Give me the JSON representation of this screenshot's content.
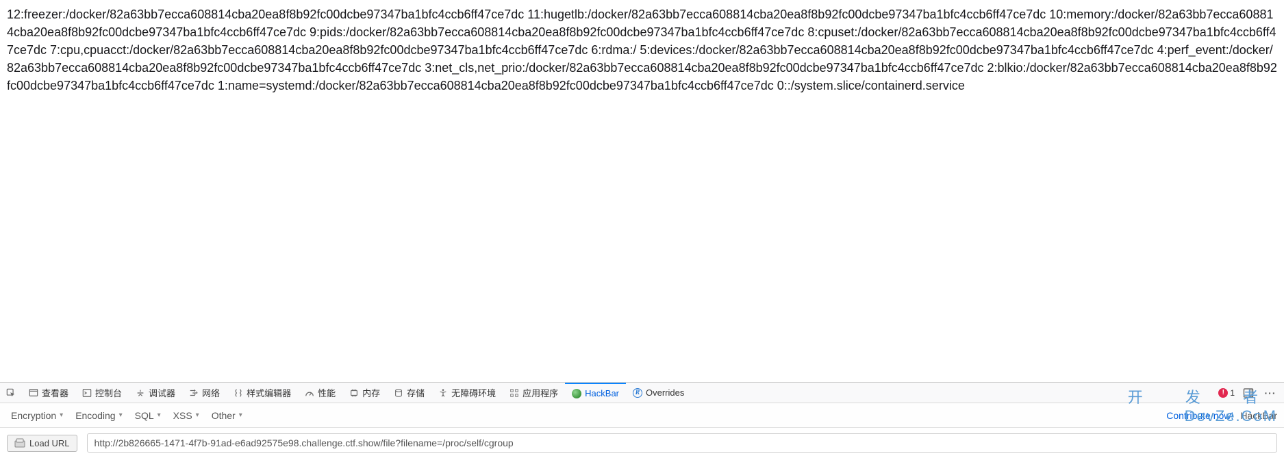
{
  "page_text": "12:freezer:/docker/82a63bb7ecca608814cba20ea8f8b92fc00dcbe97347ba1bfc4ccb6ff47ce7dc 11:hugetlb:/docker/82a63bb7ecca608814cba20ea8f8b92fc00dcbe97347ba1bfc4ccb6ff47ce7dc 10:memory:/docker/82a63bb7ecca608814cba20ea8f8b92fc00dcbe97347ba1bfc4ccb6ff47ce7dc 9:pids:/docker/82a63bb7ecca608814cba20ea8f8b92fc00dcbe97347ba1bfc4ccb6ff47ce7dc 8:cpuset:/docker/82a63bb7ecca608814cba20ea8f8b92fc00dcbe97347ba1bfc4ccb6ff47ce7dc 7:cpu,cpuacct:/docker/82a63bb7ecca608814cba20ea8f8b92fc00dcbe97347ba1bfc4ccb6ff47ce7dc 6:rdma:/ 5:devices:/docker/82a63bb7ecca608814cba20ea8f8b92fc00dcbe97347ba1bfc4ccb6ff47ce7dc 4:perf_event:/docker/82a63bb7ecca608814cba20ea8f8b92fc00dcbe97347ba1bfc4ccb6ff47ce7dc 3:net_cls,net_prio:/docker/82a63bb7ecca608814cba20ea8f8b92fc00dcbe97347ba1bfc4ccb6ff47ce7dc 2:blkio:/docker/82a63bb7ecca608814cba20ea8f8b92fc00dcbe97347ba1bfc4ccb6ff47ce7dc 1:name=systemd:/docker/82a63bb7ecca608814cba20ea8f8b92fc00dcbe97347ba1bfc4ccb6ff47ce7dc 0::/system.slice/containerd.service",
  "devtools": {
    "tabs": {
      "inspector": "查看器",
      "console": "控制台",
      "debugger": "调试器",
      "network": "网络",
      "style": "样式编辑器",
      "performance": "性能",
      "memory": "内存",
      "storage": "存储",
      "accessibility": "无障碍环境",
      "application": "应用程序",
      "hackbar": "HackBar",
      "overrides": "Overrides"
    },
    "error_count": "1"
  },
  "hackbar": {
    "menus": {
      "encryption": "Encryption",
      "encoding": "Encoding",
      "sql": "SQL",
      "xss": "XSS",
      "other": "Other"
    },
    "contribute": "Contribute now!",
    "brand": "HackBar",
    "load_label": "Load URL",
    "url_value": "http://2b826665-1471-4f7b-91ad-e6ad92575e98.challenge.ctf.show/file?filename=/proc/self/cgroup"
  },
  "watermark": {
    "line1": "开 发 者",
    "line2": "DevZe.CoM"
  }
}
